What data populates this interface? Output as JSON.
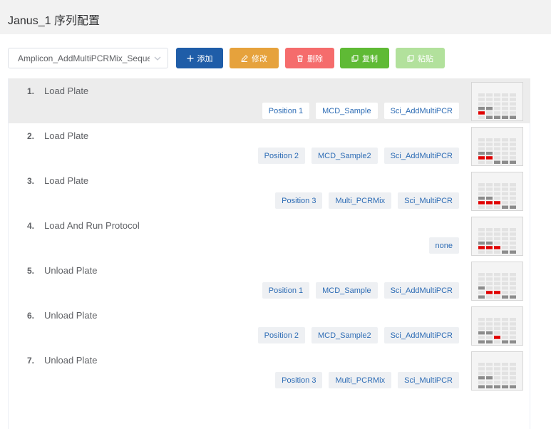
{
  "header": {
    "title": "Janus_1 序列配置"
  },
  "toolbar": {
    "sequence_select": "Amplicon_AddMultiPCRMix_Sequence",
    "add_label": "添加",
    "edit_label": "修改",
    "delete_label": "删除",
    "copy_label": "复制",
    "paste_label": "粘贴"
  },
  "colors": {
    "primary": "#1f5da8",
    "warning": "#e6a23c",
    "danger": "#f56c6c",
    "success": "#5fba35",
    "success_disabled": "#b2e19c",
    "well_red": "#e00000",
    "well_gray": "#8c8c8c"
  },
  "steps": [
    {
      "num": "1.",
      "name": "Load Plate",
      "tags": [
        "Position 1",
        "MCD_Sample",
        "Sci_AddMultiPCR"
      ],
      "selected": true,
      "plate": {
        "gray": [
          [
            3,
            0
          ],
          [
            3,
            1
          ]
        ],
        "red": [
          [
            4,
            0
          ]
        ],
        "bottom_gray": [
          1,
          2,
          3,
          4
        ]
      }
    },
    {
      "num": "2.",
      "name": "Load Plate",
      "tags": [
        "Position 2",
        "MCD_Sample2",
        "Sci_AddMultiPCR"
      ],
      "plate": {
        "gray": [
          [
            3,
            0
          ],
          [
            3,
            1
          ]
        ],
        "red": [
          [
            4,
            0
          ],
          [
            4,
            1
          ]
        ],
        "bottom_gray": [
          2,
          3,
          4
        ]
      }
    },
    {
      "num": "3.",
      "name": "Load Plate",
      "tags": [
        "Position 3",
        "Multi_PCRMix",
        "Sci_MultiPCR"
      ],
      "plate": {
        "gray": [
          [
            3,
            0
          ],
          [
            3,
            1
          ]
        ],
        "red": [
          [
            4,
            0
          ],
          [
            4,
            1
          ],
          [
            4,
            2
          ]
        ],
        "bottom_gray": [
          3,
          4
        ]
      }
    },
    {
      "num": "4.",
      "name": "Load And Run Protocol",
      "tags": [
        "none"
      ],
      "plate": {
        "gray": [
          [
            3,
            0
          ],
          [
            3,
            1
          ]
        ],
        "red": [
          [
            4,
            0
          ],
          [
            4,
            1
          ],
          [
            4,
            2
          ]
        ],
        "bottom_gray": [
          3,
          4
        ]
      }
    },
    {
      "num": "5.",
      "name": "Unload Plate",
      "tags": [
        "Position 1",
        "MCD_Sample",
        "Sci_AddMultiPCR"
      ],
      "plate": {
        "gray": [
          [
            3,
            0
          ]
        ],
        "red": [
          [
            4,
            1
          ],
          [
            4,
            2
          ]
        ],
        "bottom_gray": [
          0,
          3,
          4
        ]
      }
    },
    {
      "num": "6.",
      "name": "Unload Plate",
      "tags": [
        "Position 2",
        "MCD_Sample2",
        "Sci_AddMultiPCR"
      ],
      "plate": {
        "gray": [
          [
            3,
            0
          ],
          [
            3,
            1
          ]
        ],
        "red": [
          [
            4,
            2
          ]
        ],
        "bottom_gray": [
          0,
          1,
          3,
          4
        ]
      }
    },
    {
      "num": "7.",
      "name": "Unload Plate",
      "tags": [
        "Position 3",
        "Multi_PCRMix",
        "Sci_MultiPCR"
      ],
      "plate": {
        "gray": [
          [
            3,
            0
          ],
          [
            3,
            1
          ]
        ],
        "red": [],
        "bottom_gray": [
          0,
          1,
          2,
          3,
          4
        ]
      }
    }
  ]
}
